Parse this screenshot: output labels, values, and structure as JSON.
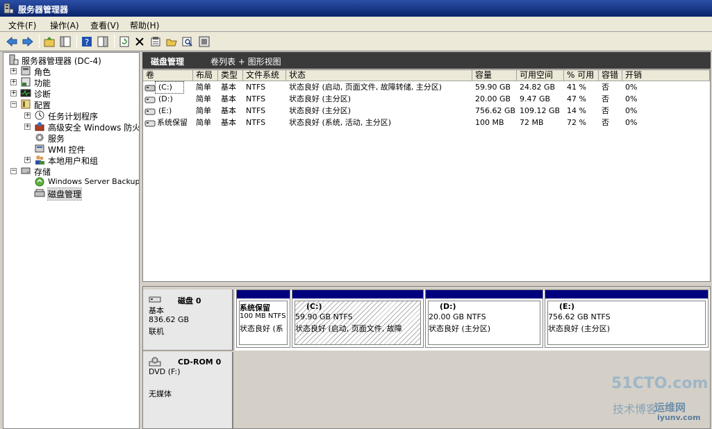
{
  "window": {
    "title": "服务器管理器"
  },
  "menu": [
    {
      "label": "文件(F)"
    },
    {
      "label": "操作(A)"
    },
    {
      "label": "查看(V)"
    },
    {
      "label": "帮助(H)"
    }
  ],
  "toolbar": {
    "icons": [
      "back-icon",
      "forward-icon",
      "up-folder-icon",
      "show-hide-tree-icon",
      "help-icon",
      "properties-pane-icon",
      "refresh-icon",
      "delete-icon",
      "properties-icon",
      "open-icon",
      "find-icon",
      "settings-icon"
    ]
  },
  "nav": {
    "root": "服务器管理器 (DC-4)",
    "roles": "角色",
    "features": "功能",
    "diagnostics": "诊断",
    "configuration": "配置",
    "task_scheduler": "任务计划程序",
    "firewall": "高级安全 Windows 防火墙",
    "services": "服务",
    "wmi": "WMI 控件",
    "local_users": "本地用户和组",
    "storage": "存储",
    "backup": "Windows Server Backup",
    "disk_mgmt": "磁盘管理"
  },
  "main": {
    "title": "磁盘管理",
    "view": "卷列表 + 图形视图"
  },
  "volumes": {
    "columns": [
      "卷",
      "布局",
      "类型",
      "文件系统",
      "状态",
      "容量",
      "可用空间",
      "% 可用",
      "容错",
      "开销"
    ],
    "rows": [
      {
        "name": "(C:)",
        "layout": "简单",
        "type": "基本",
        "fs": "NTFS",
        "status": "状态良好 (启动, 页面文件, 故障转储, 主分区)",
        "capacity": "59.90 GB",
        "free": "24.82 GB",
        "pct": "41 %",
        "fault": "否",
        "overhead": "0%"
      },
      {
        "name": "(D:)",
        "layout": "简单",
        "type": "基本",
        "fs": "NTFS",
        "status": "状态良好 (主分区)",
        "capacity": "20.00 GB",
        "free": "9.47 GB",
        "pct": "47 %",
        "fault": "否",
        "overhead": "0%"
      },
      {
        "name": "(E:)",
        "layout": "简单",
        "type": "基本",
        "fs": "NTFS",
        "status": "状态良好 (主分区)",
        "capacity": "756.62 GB",
        "free": "109.12 GB",
        "pct": "14 %",
        "fault": "否",
        "overhead": "0%"
      },
      {
        "name": "系统保留",
        "layout": "简单",
        "type": "基本",
        "fs": "NTFS",
        "status": "状态良好 (系统, 活动, 主分区)",
        "capacity": "100 MB",
        "free": "72 MB",
        "pct": "72 %",
        "fault": "否",
        "overhead": "0%"
      }
    ]
  },
  "disk0": {
    "name": "磁盘 0",
    "type": "基本",
    "size": "836.62 GB",
    "state": "联机",
    "partitions": [
      {
        "name": "系统保留",
        "size": "100 MB NTFS",
        "status": "状态良好 (系"
      },
      {
        "name": "(C:)",
        "size": "59.90 GB NTFS",
        "status": "状态良好 (启动, 页面文件, 故障"
      },
      {
        "name": "(D:)",
        "size": "20.00 GB NTFS",
        "status": "状态良好 (主分区)"
      },
      {
        "name": "(E:)",
        "size": "756.62 GB NTFS",
        "status": "状态良好 (主分区)"
      }
    ]
  },
  "cdrom0": {
    "name": "CD-ROM 0",
    "drive": "DVD (F:)",
    "media": "无媒体"
  },
  "watermark": {
    "site": "51CTO.com",
    "blog": "技术博客",
    "ops": "运维网",
    "domain": "iyunv.com"
  }
}
